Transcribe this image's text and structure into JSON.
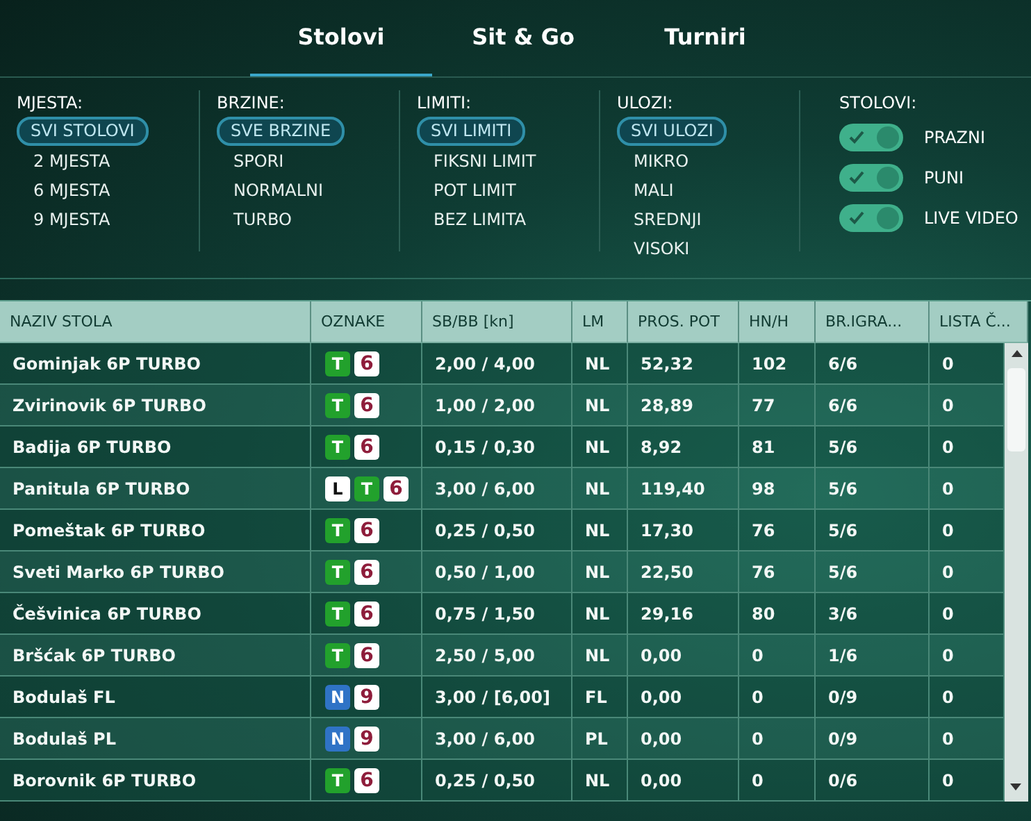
{
  "tabs": [
    {
      "label": "Stolovi",
      "selected": true
    },
    {
      "label": "Sit & Go",
      "selected": false
    },
    {
      "label": "Turniri",
      "selected": false
    }
  ],
  "filters": [
    {
      "title": "MJESTA:",
      "options": [
        {
          "label": "SVI STOLOVI",
          "selected": true
        },
        {
          "label": "2 MJESTA",
          "selected": false
        },
        {
          "label": "6 MJESTA",
          "selected": false
        },
        {
          "label": "9 MJESTA",
          "selected": false
        }
      ]
    },
    {
      "title": "BRZINE:",
      "options": [
        {
          "label": "SVE BRZINE",
          "selected": true
        },
        {
          "label": "SPORI",
          "selected": false
        },
        {
          "label": "NORMALNI",
          "selected": false
        },
        {
          "label": "TURBO",
          "selected": false
        }
      ]
    },
    {
      "title": "LIMITI:",
      "options": [
        {
          "label": "SVI LIMITI",
          "selected": true
        },
        {
          "label": "FIKSNI LIMIT",
          "selected": false
        },
        {
          "label": "POT LIMIT",
          "selected": false
        },
        {
          "label": "BEZ LIMITA",
          "selected": false
        }
      ]
    },
    {
      "title": "ULOZI:",
      "options": [
        {
          "label": "SVI ULOZI",
          "selected": true
        },
        {
          "label": "MIKRO",
          "selected": false
        },
        {
          "label": "MALI",
          "selected": false
        },
        {
          "label": "SREDNJI",
          "selected": false
        },
        {
          "label": "VISOKI",
          "selected": false
        }
      ]
    }
  ],
  "toggles": {
    "title": "STOLOVI:",
    "items": [
      {
        "label": "PRAZNI",
        "on": true
      },
      {
        "label": "PUNI",
        "on": true
      },
      {
        "label": "LIVE VIDEO",
        "on": true
      }
    ]
  },
  "table": {
    "columns": [
      "NAZIV STOLA",
      "OZNAKE",
      "SB/BB [kn]",
      "LM",
      "PROS. POT",
      "HN/H",
      "BR.IGRA...",
      "LISTA Č..."
    ],
    "rows": [
      {
        "name": "Gominjak 6P TURBO",
        "tags": [
          {
            "kind": "letter",
            "text": "T",
            "color": "#22a12c"
          },
          {
            "kind": "number",
            "text": "6"
          }
        ],
        "blinds": "2,00 / 4,00",
        "lm": "NL",
        "pot": "52,32",
        "hnh": "102",
        "players": "6/6",
        "waiting": "0"
      },
      {
        "name": "Zvirinovik 6P TURBO",
        "tags": [
          {
            "kind": "letter",
            "text": "T",
            "color": "#22a12c"
          },
          {
            "kind": "number",
            "text": "6"
          }
        ],
        "blinds": "1,00 / 2,00",
        "lm": "NL",
        "pot": "28,89",
        "hnh": "77",
        "players": "6/6",
        "waiting": "0"
      },
      {
        "name": "Badija 6P TURBO",
        "tags": [
          {
            "kind": "letter",
            "text": "T",
            "color": "#22a12c"
          },
          {
            "kind": "number",
            "text": "6"
          }
        ],
        "blinds": "0,15 / 0,30",
        "lm": "NL",
        "pot": "8,92",
        "hnh": "81",
        "players": "5/6",
        "waiting": "0"
      },
      {
        "name": "Panitula 6P TURBO",
        "tags": [
          {
            "kind": "plain",
            "text": "L"
          },
          {
            "kind": "letter",
            "text": "T",
            "color": "#22a12c"
          },
          {
            "kind": "number",
            "text": "6"
          }
        ],
        "blinds": "3,00 / 6,00",
        "lm": "NL",
        "pot": "119,40",
        "hnh": "98",
        "players": "5/6",
        "waiting": "0"
      },
      {
        "name": "Pomeštak 6P TURBO",
        "tags": [
          {
            "kind": "letter",
            "text": "T",
            "color": "#22a12c"
          },
          {
            "kind": "number",
            "text": "6"
          }
        ],
        "blinds": "0,25 / 0,50",
        "lm": "NL",
        "pot": "17,30",
        "hnh": "76",
        "players": "5/6",
        "waiting": "0"
      },
      {
        "name": "Sveti Marko 6P TURBO",
        "tags": [
          {
            "kind": "letter",
            "text": "T",
            "color": "#22a12c"
          },
          {
            "kind": "number",
            "text": "6"
          }
        ],
        "blinds": "0,50 / 1,00",
        "lm": "NL",
        "pot": "22,50",
        "hnh": "76",
        "players": "5/6",
        "waiting": "0"
      },
      {
        "name": "Češvinica 6P TURBO",
        "tags": [
          {
            "kind": "letter",
            "text": "T",
            "color": "#22a12c"
          },
          {
            "kind": "number",
            "text": "6"
          }
        ],
        "blinds": "0,75 / 1,50",
        "lm": "NL",
        "pot": "29,16",
        "hnh": "80",
        "players": "3/6",
        "waiting": "0"
      },
      {
        "name": "Bršćak 6P TURBO",
        "tags": [
          {
            "kind": "letter",
            "text": "T",
            "color": "#22a12c"
          },
          {
            "kind": "number",
            "text": "6"
          }
        ],
        "blinds": "2,50 / 5,00",
        "lm": "NL",
        "pot": "0,00",
        "hnh": "0",
        "players": "1/6",
        "waiting": "0"
      },
      {
        "name": "Bodulaš FL",
        "tags": [
          {
            "kind": "letter",
            "text": "N",
            "color": "#2f73c6"
          },
          {
            "kind": "number",
            "text": "9"
          }
        ],
        "blinds": "3,00 / [6,00]",
        "lm": "FL",
        "pot": "0,00",
        "hnh": "0",
        "players": "0/9",
        "waiting": "0"
      },
      {
        "name": "Bodulaš PL",
        "tags": [
          {
            "kind": "letter",
            "text": "N",
            "color": "#2f73c6"
          },
          {
            "kind": "number",
            "text": "9"
          }
        ],
        "blinds": "3,00 / 6,00",
        "lm": "PL",
        "pot": "0,00",
        "hnh": "0",
        "players": "0/9",
        "waiting": "0"
      },
      {
        "name": "Borovnik 6P TURBO",
        "tags": [
          {
            "kind": "letter",
            "text": "T",
            "color": "#22a12c"
          },
          {
            "kind": "number",
            "text": "6"
          }
        ],
        "blinds": "0,25 / 0,50",
        "lm": "NL",
        "pot": "0,00",
        "hnh": "0",
        "players": "0/6",
        "waiting": "0"
      }
    ]
  }
}
